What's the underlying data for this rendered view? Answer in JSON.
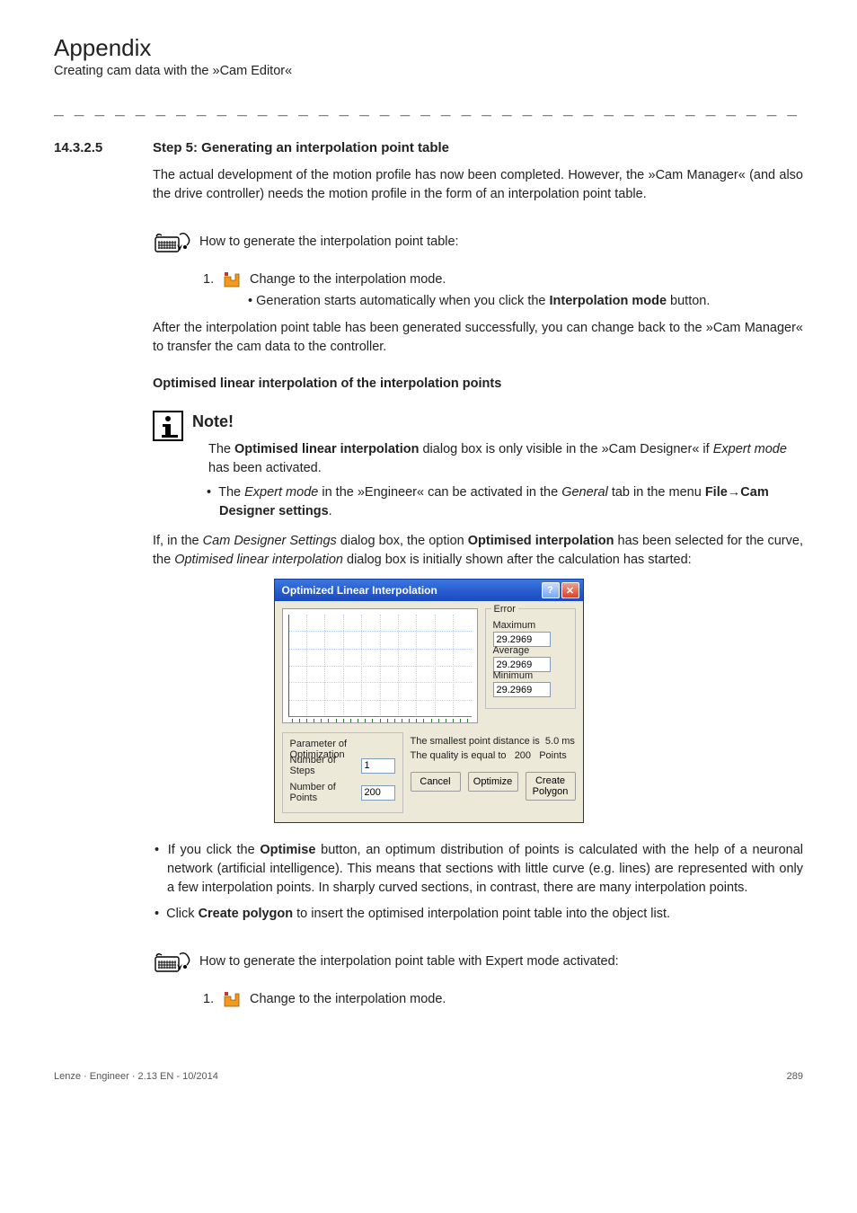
{
  "header": {
    "title": "Appendix",
    "subtitle": "Creating cam data with the »Cam Editor«"
  },
  "section": {
    "number": "14.3.2.5",
    "title": "Step 5: Generating an interpolation point table"
  },
  "intro_para": "The actual development of the motion profile has now been completed. However, the »Cam Manager« (and also the drive controller) needs the motion profile in the form of an interpolation point table.",
  "howto1": "How to generate the interpolation point table:",
  "step1": {
    "num": "1.",
    "text": "Change to the interpolation mode.",
    "sub": "Generation starts automatically when you click the <b>Interpolation mode</b> button."
  },
  "after_step_para": "After the interpolation point table has been generated successfully, you can change back to the »Cam Manager« to transfer the cam data to the controller.",
  "subhead_opt": "Optimised linear interpolation of the interpolation points",
  "note": {
    "title": "Note!",
    "p1": "The <b>Optimised linear interpolation</b> dialog box is only visible in the »Cam Designer« if <i>Expert mode</i> has been activated.",
    "b1": "The <i>Expert mode</i> in the »Engineer« can be activated in the <i>General</i>  tab in the menu <b>File</b><span class=\"arrow\">→</span><b>Cam Designer settings</b>."
  },
  "para_after_note": "If, in the <i>Cam Designer Settings</i> dialog box, the option <b>Optimised interpolation</b> has been selected for the curve, the <i>Optimised linear interpolation</i> dialog box is initially shown after the calculation has started:",
  "dialog": {
    "title": "Optimized Linear Interpolation",
    "help": "?",
    "close": "✕",
    "error_legend": "Error",
    "max_label": "Maximum",
    "max_val": "29.2969",
    "avg_label": "Average",
    "avg_val": "29.2969",
    "min_label": "Minimum",
    "min_val": "29.2969",
    "po_legend": "Parameter of Optimization",
    "steps_label": "Number of Steps",
    "steps_val": "1",
    "points_label": "Number of Points",
    "points_val": "200",
    "stat1_a": "The smallest point distance is",
    "stat1_b": "5.0 ms",
    "stat2_a": "The quality is equal to",
    "stat2_b": "200",
    "stat2_c": "Points",
    "btn_cancel": "Cancel",
    "btn_optimize": "Optimize",
    "btn_create": "Create\nPolygon"
  },
  "bullets_after": {
    "b1": "If you click the <b>Optimise</b> button, an optimum distribution of points is calculated with the help of a neuronal network (artificial intelligence). This means that sections with little curve (e.g. lines) are represented with only a few interpolation points. In sharply curved sections, in contrast, there are many interpolation points.",
    "b2": "Click <b>Create polygon</b> to insert the optimised interpolation point table into the object list."
  },
  "howto2": "How to generate the interpolation point table with Expert mode activated:",
  "step2": {
    "num": "1.",
    "text": "Change to the interpolation mode."
  },
  "footer": {
    "left": "Lenze · Engineer · 2.13 EN - 10/2014",
    "right": "289"
  }
}
